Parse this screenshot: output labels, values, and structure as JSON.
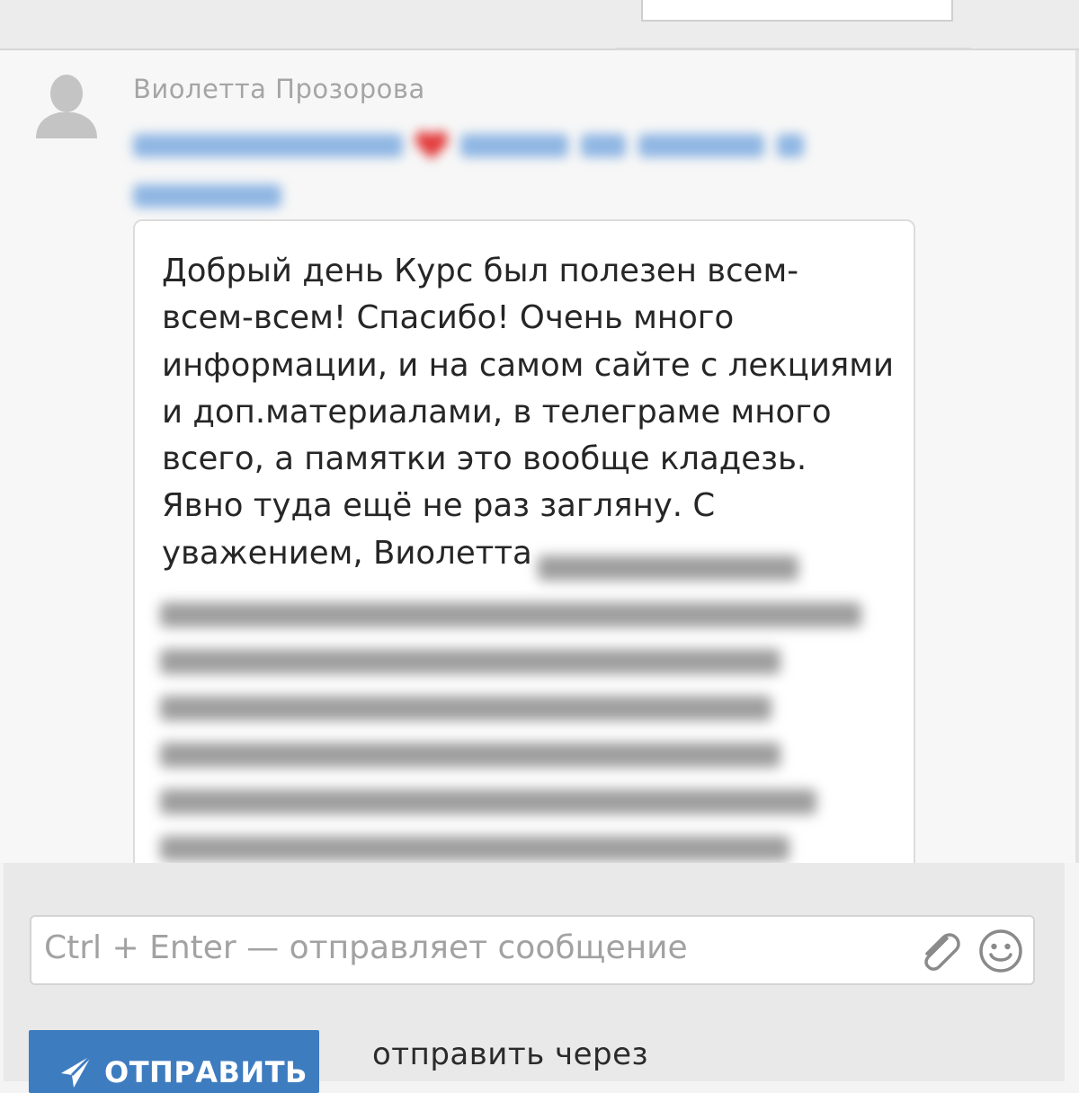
{
  "message": {
    "sender_name": "Виолетта Прозорова",
    "body_lines": [
      "Добрый день Курс был полезен всем-",
      "всем-всем! Спасибо! Очень много",
      "информации, и на самом сайте с лекциями",
      "и доп.материалами, в телеграме много",
      "всего, а памятки это вообще кладезь.",
      "Явно туда ещё не раз загляну. С",
      "уважением, Виолетта"
    ]
  },
  "composer": {
    "placeholder": "Ctrl + Enter — отправляет сообщение",
    "send_label": "ОТПРАВИТЬ",
    "send_via_label": "отправить через"
  },
  "icons": {
    "avatar": "user-silhouette-icon",
    "attach": "paperclip-icon",
    "emoji": "smiley-icon",
    "send": "paper-plane-icon"
  },
  "colors": {
    "accent": "#3e7cc0",
    "subject_link": "#8fb6e3"
  }
}
